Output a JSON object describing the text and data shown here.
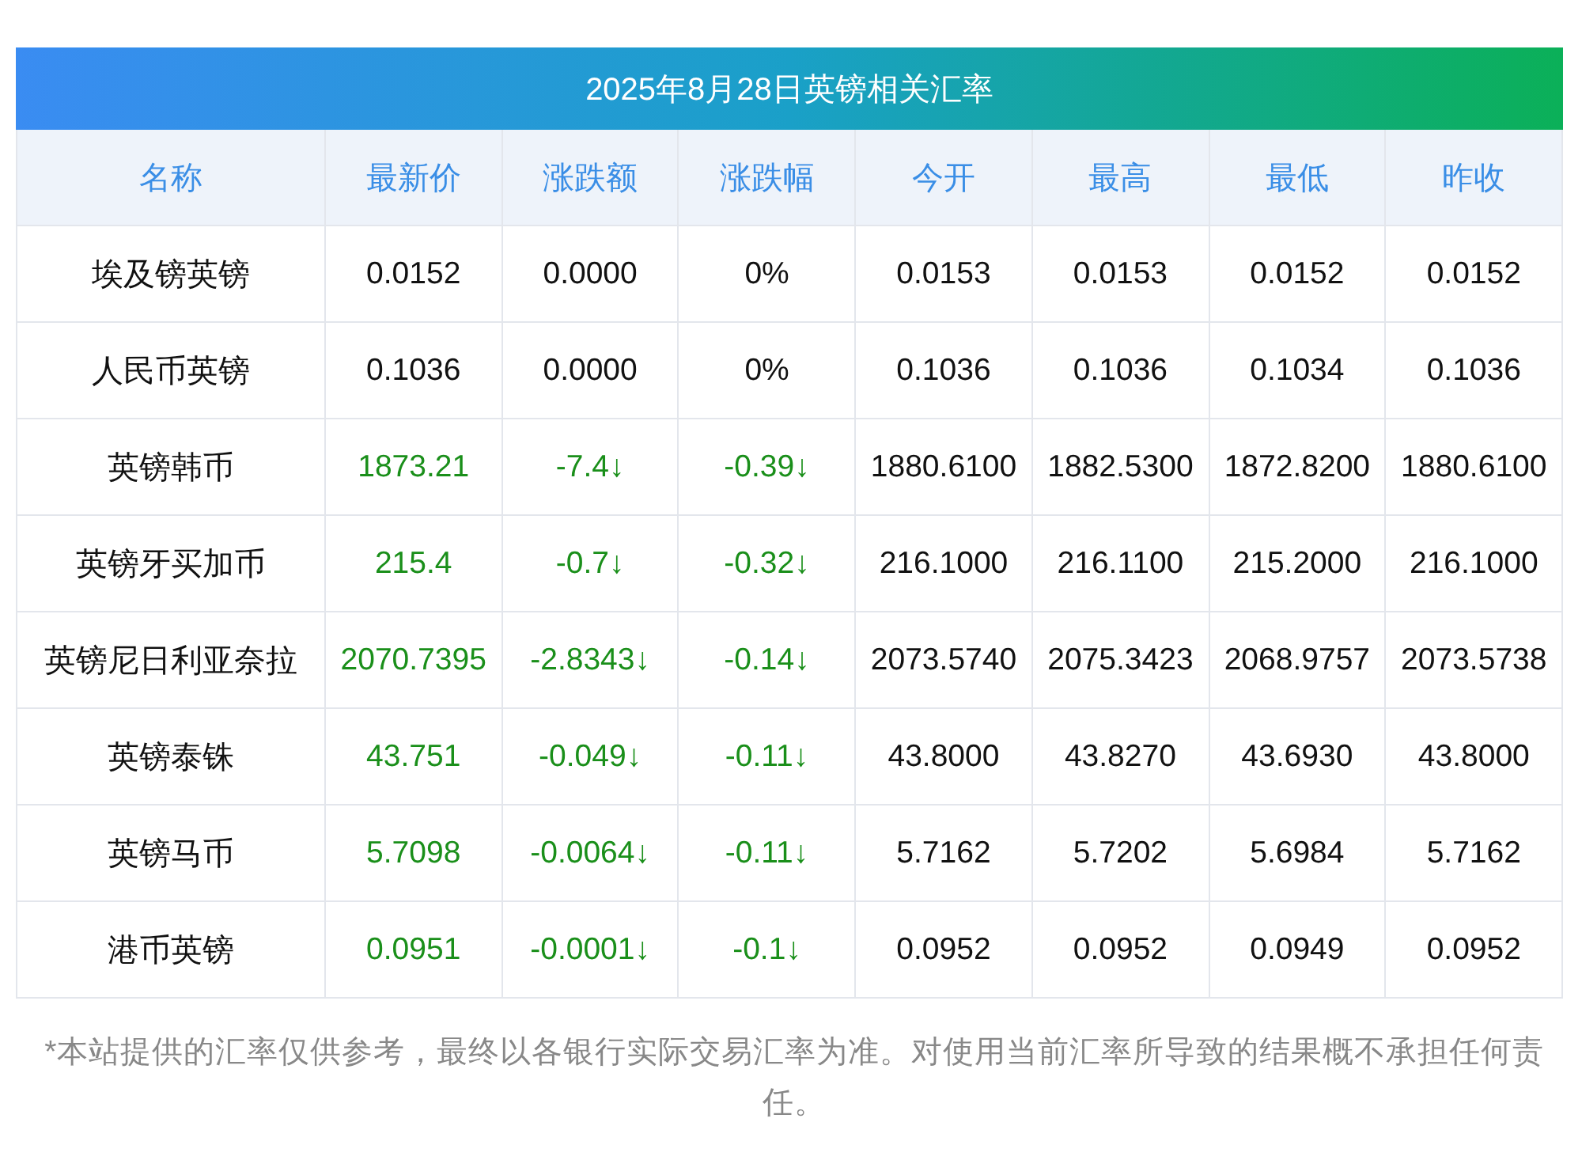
{
  "title": "2025年8月28日英镑相关汇率",
  "columns": [
    "名称",
    "最新价",
    "涨跌额",
    "涨跌幅",
    "今开",
    "最高",
    "最低",
    "昨收"
  ],
  "rows": [
    {
      "color": "#111111",
      "cells": [
        "埃及镑英镑",
        "0.0152",
        "0.0000",
        "0%",
        "0.0153",
        "0.0153",
        "0.0152",
        "0.0152"
      ]
    },
    {
      "color": "#111111",
      "cells": [
        "人民币英镑",
        "0.1036",
        "0.0000",
        "0%",
        "0.1036",
        "0.1036",
        "0.1034",
        "0.1036"
      ]
    },
    {
      "color": "#1a8f1a",
      "cells": [
        "英镑韩币",
        "1873.21",
        "-7.4↓",
        "-0.39↓",
        "1880.6100",
        "1882.5300",
        "1872.8200",
        "1880.6100"
      ]
    },
    {
      "color": "#1a8f1a",
      "cells": [
        "英镑牙买加币",
        "215.4",
        "-0.7↓",
        "-0.32↓",
        "216.1000",
        "216.1100",
        "215.2000",
        "216.1000"
      ]
    },
    {
      "color": "#1a8f1a",
      "cells": [
        "英镑尼日利亚奈拉",
        "2070.7395",
        "-2.8343↓",
        "-0.14↓",
        "2073.5740",
        "2075.3423",
        "2068.9757",
        "2073.5738"
      ]
    },
    {
      "color": "#1a8f1a",
      "cells": [
        "英镑泰铢",
        "43.751",
        "-0.049↓",
        "-0.11↓",
        "43.8000",
        "43.8270",
        "43.6930",
        "43.8000"
      ]
    },
    {
      "color": "#1a8f1a",
      "cells": [
        "英镑马币",
        "5.7098",
        "-0.0064↓",
        "-0.11↓",
        "5.7162",
        "5.7202",
        "5.6984",
        "5.7162"
      ]
    },
    {
      "color": "#1a8f1a",
      "cells": [
        "港币英镑",
        "0.0951",
        "-0.0001↓",
        "-0.1↓",
        "0.0952",
        "0.0952",
        "0.0949",
        "0.0952"
      ]
    }
  ],
  "note": "*本站提供的汇率仅供参考，最终以各银行实际交易汇率为准。对使用当前汇率所导致的结果概不承担任何责任。"
}
